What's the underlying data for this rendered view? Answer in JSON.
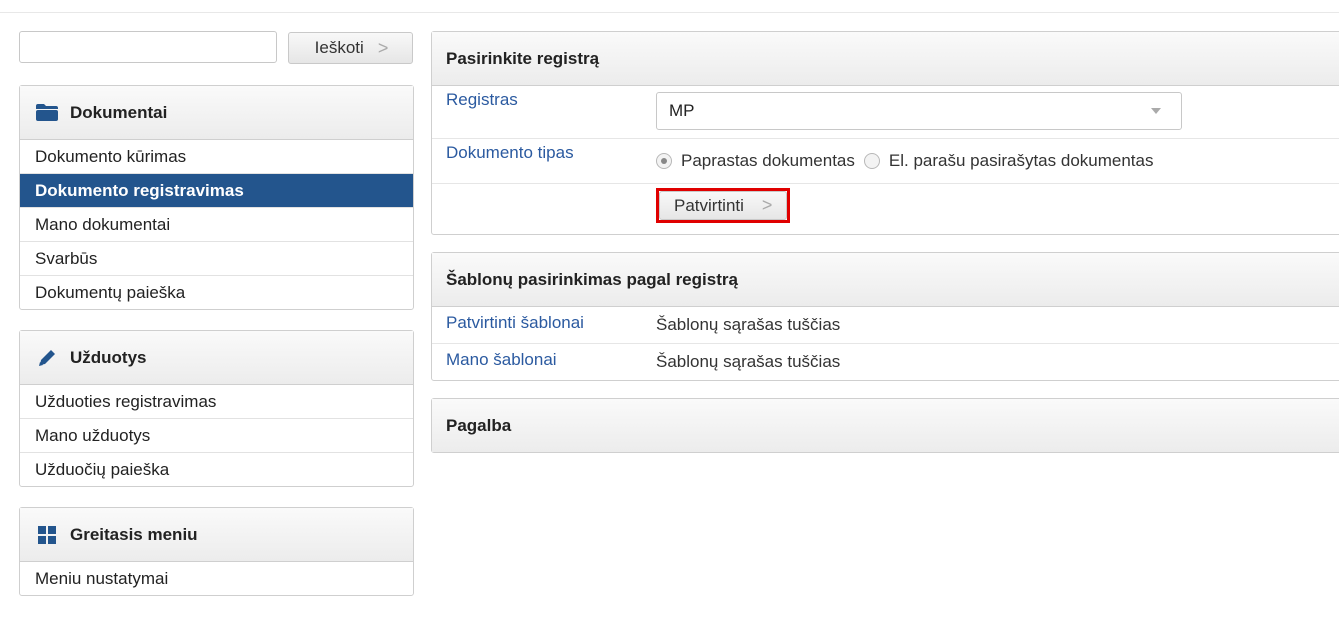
{
  "search": {
    "placeholder": "",
    "value": "",
    "button_label": "Ieškoti"
  },
  "sidebar": {
    "sections": [
      {
        "title": "Dokumentai",
        "icon": "folder-icon",
        "items": [
          "Dokumento kūrimas",
          "Dokumento registravimas",
          "Mano dokumentai",
          "Svarbūs",
          "Dokumentų paieška"
        ],
        "active_index": 1
      },
      {
        "title": "Užduotys",
        "icon": "pencil-icon",
        "items": [
          "Užduoties registravimas",
          "Mano užduotys",
          "Užduočių paieška"
        ]
      },
      {
        "title": "Greitasis meniu",
        "icon": "grid-icon",
        "items": [
          "Meniu nustatymai"
        ]
      }
    ]
  },
  "register_panel": {
    "title": "Pasirinkite registrą",
    "registras_label": "Registras",
    "registras_value": "MP",
    "doc_type_label": "Dokumento tipas",
    "doc_type_options": [
      "Paprastas dokumentas",
      "El. parašu pasirašytas dokumentas"
    ],
    "doc_type_selected": "Paprastas dokumentas",
    "confirm_label": "Patvirtinti",
    "confirm_highlight_color": "#e00000"
  },
  "templates_panel": {
    "title": "Šablonų pasirinkimas pagal registrą",
    "rows": [
      {
        "label": "Patvirtinti šablonai",
        "value": "Šablonų sąrašas tuščias"
      },
      {
        "label": "Mano šablonai",
        "value": "Šablonų sąrašas tuščias"
      }
    ]
  },
  "help_panel": {
    "title": "Pagalba"
  },
  "colors": {
    "active_menu_bg": "#23558d",
    "link_label": "#2b5aa0"
  }
}
